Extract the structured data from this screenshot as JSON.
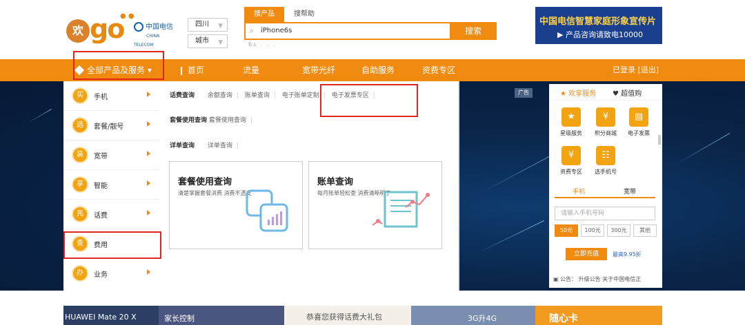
{
  "header": {
    "logo_huan": "欢",
    "logo_go": "go",
    "telecom_cn": "中国电信",
    "telecom_en": "CHINA TELECOM",
    "province": "四川",
    "city": "城市",
    "search_tabs": [
      "搜产品",
      "搜帮助"
    ],
    "search_value": "iPhone6s",
    "search_button": "搜索",
    "hotwords": "6s  .  .  .",
    "ad_line1": "中国电信智慧家庭形象宣传片",
    "ad_line2": "▶ 产品咨询请致电10000"
  },
  "nav": {
    "all_products": "全部产品及服务",
    "links": [
      "首页",
      "流量",
      "宽带光纤",
      "自助服务",
      "资费专区"
    ],
    "logged_in": "已登录",
    "logout": "[退出]"
  },
  "categories": [
    {
      "icon": "买",
      "label": "手机"
    },
    {
      "icon": "选",
      "label": "套餐/靓号"
    },
    {
      "icon": "装",
      "label": "宽带"
    },
    {
      "icon": "享",
      "label": "智能"
    },
    {
      "icon": "充",
      "label": "话费"
    },
    {
      "icon": "查",
      "label": "费用"
    },
    {
      "icon": "办",
      "label": "业务"
    }
  ],
  "flyout": {
    "row1_head": "话费查询",
    "row1_links": [
      "余额查询",
      "账单查询",
      "电子账单定制",
      "电子发票专区"
    ],
    "row2_head": "套餐使用查询",
    "row2_links": [
      "套餐使用查询"
    ],
    "row3_head": "详单查询",
    "row3_links": [
      "详单查询"
    ],
    "card1_title": "套餐使用查询",
    "card1_desc": "清楚掌握套餐消费 消费不透支",
    "card2_title": "账单查询",
    "card2_desc": "每月账单轻松查 消费清晰明了"
  },
  "ad_label": "广告",
  "right_panel": {
    "tab1": "欢享服务",
    "tab2": "超值购",
    "services": [
      {
        "icon": "★",
        "label": "星级服务"
      },
      {
        "icon": "¥",
        "label": "积分商城"
      },
      {
        "icon": "▤",
        "label": "电子发票"
      },
      {
        "icon": "¥",
        "label": "资费专区"
      },
      {
        "icon": "☷",
        "label": "选手机号"
      }
    ],
    "recharge_tabs": [
      "手机",
      "宽带"
    ],
    "phone_placeholder": "请输入手机号码",
    "amounts": [
      "50元",
      "100元",
      "300元",
      "其他"
    ],
    "pay_button": "立即充值",
    "discount": "最高9.95折",
    "notice": "公告：  升级公告    关于中国电信正"
  },
  "bottom_ads": [
    "HUAWEI Mate 20 X",
    "家长控制",
    "恭喜您获得话费大礼包",
    "3G升4G",
    "随心卡"
  ],
  "colors": {
    "orange": "#f08b10",
    "red_box": "#e0261c",
    "dark_bg": "#0a2448"
  }
}
